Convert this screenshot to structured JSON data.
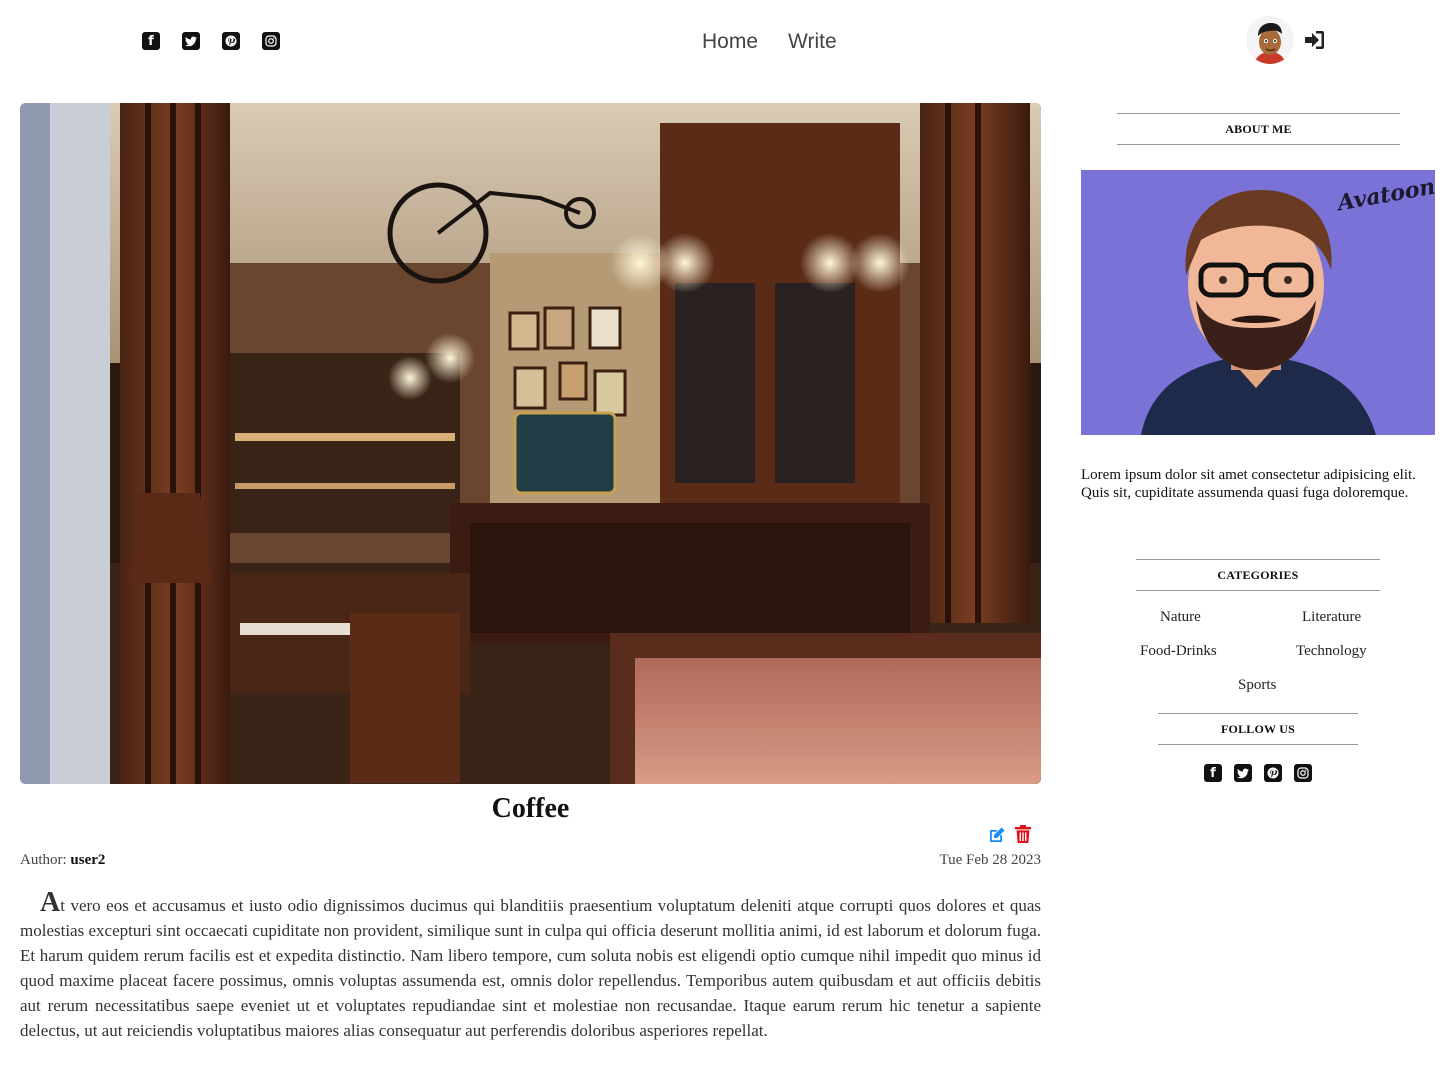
{
  "nav": {
    "home": "Home",
    "write": "Write"
  },
  "social_icons": [
    "facebook-icon",
    "twitter-icon",
    "pinterest-icon",
    "instagram-icon"
  ],
  "post": {
    "title": "Coffee",
    "author_label": "Author:",
    "author": "user2",
    "date": "Tue Feb 28 2023",
    "drop_cap": "A",
    "body": "t vero eos et accusamus et iusto odio dignissimos ducimus qui blanditiis praesentium voluptatum deleniti atque corrupti quos dolores et quas molestias excepturi sint occaecati cupiditate non provident, similique sunt in culpa qui officia deserunt mollitia animi, id est laborum et dolorum fuga. Et harum quidem rerum facilis est et expedita distinctio. Nam libero tempore, cum soluta nobis est eligendi optio cumque nihil impedit quo minus id quod maxime placeat facere possimus, omnis voluptas assumenda est, omnis dolor repellendus. Temporibus autem quibusdam et aut officiis debitis aut rerum necessitatibus saepe eveniet ut et voluptates repudiandae sint et molestiae non recusandae. Itaque earum rerum hic tenetur a sapiente delectus, ut aut reiciendis voluptatibus maiores alias consequatur aut perferendis doloribus asperiores repellat."
  },
  "sidebar": {
    "about_title": "ABOUT ME",
    "about_text": "Lorem ipsum dolor sit amet consectetur adipisicing elit. Quis sit, cupiditate assumenda quasi fuga doloremque.",
    "avatar_watermark": "Avatoon",
    "categories_title": "CATEGORIES",
    "categories": [
      "Nature",
      "Literature",
      "Food-Drinks",
      "Technology",
      "Sports"
    ],
    "follow_title": "FOLLOW US"
  },
  "colors": {
    "edit": "#1a8cff",
    "delete": "#e0101a",
    "about_bg": "#7a72d6"
  }
}
